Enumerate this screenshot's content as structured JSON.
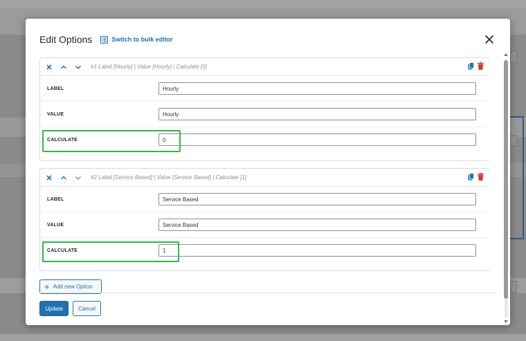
{
  "modal": {
    "title": "Edit Options",
    "bulk_editor_label": "Switch to bulk editor"
  },
  "options": [
    {
      "summary": "#1 Label [Hourly] | Value [Hourly] | Calculate [0]",
      "label_field": "LABEL",
      "label_value": "Hourly",
      "value_field": "VALUE",
      "value_value": "Hourly",
      "calculate_field": "CALCULATE",
      "calculate_value": "0"
    },
    {
      "summary": "#2 Label [Service Based] | Value [Service Based] | Calculate [1]",
      "label_field": "LABEL",
      "label_value": "Service Based",
      "value_field": "VALUE",
      "value_value": "Service Based",
      "calculate_field": "CALCULATE",
      "calculate_value": "1"
    }
  ],
  "add_option_label": "Add new Option",
  "buttons": {
    "update": "Update",
    "cancel": "Cancel"
  },
  "icons": {
    "remove": "x-icon",
    "move_up": "chevron-up-icon",
    "move_down": "chevron-down-icon",
    "duplicate": "copy-icon",
    "delete": "trash-icon",
    "bulk": "list-icon",
    "close": "close-icon"
  },
  "colors": {
    "accent": "#2271b1",
    "delete": "#d63638",
    "highlight": "#2db84a"
  }
}
